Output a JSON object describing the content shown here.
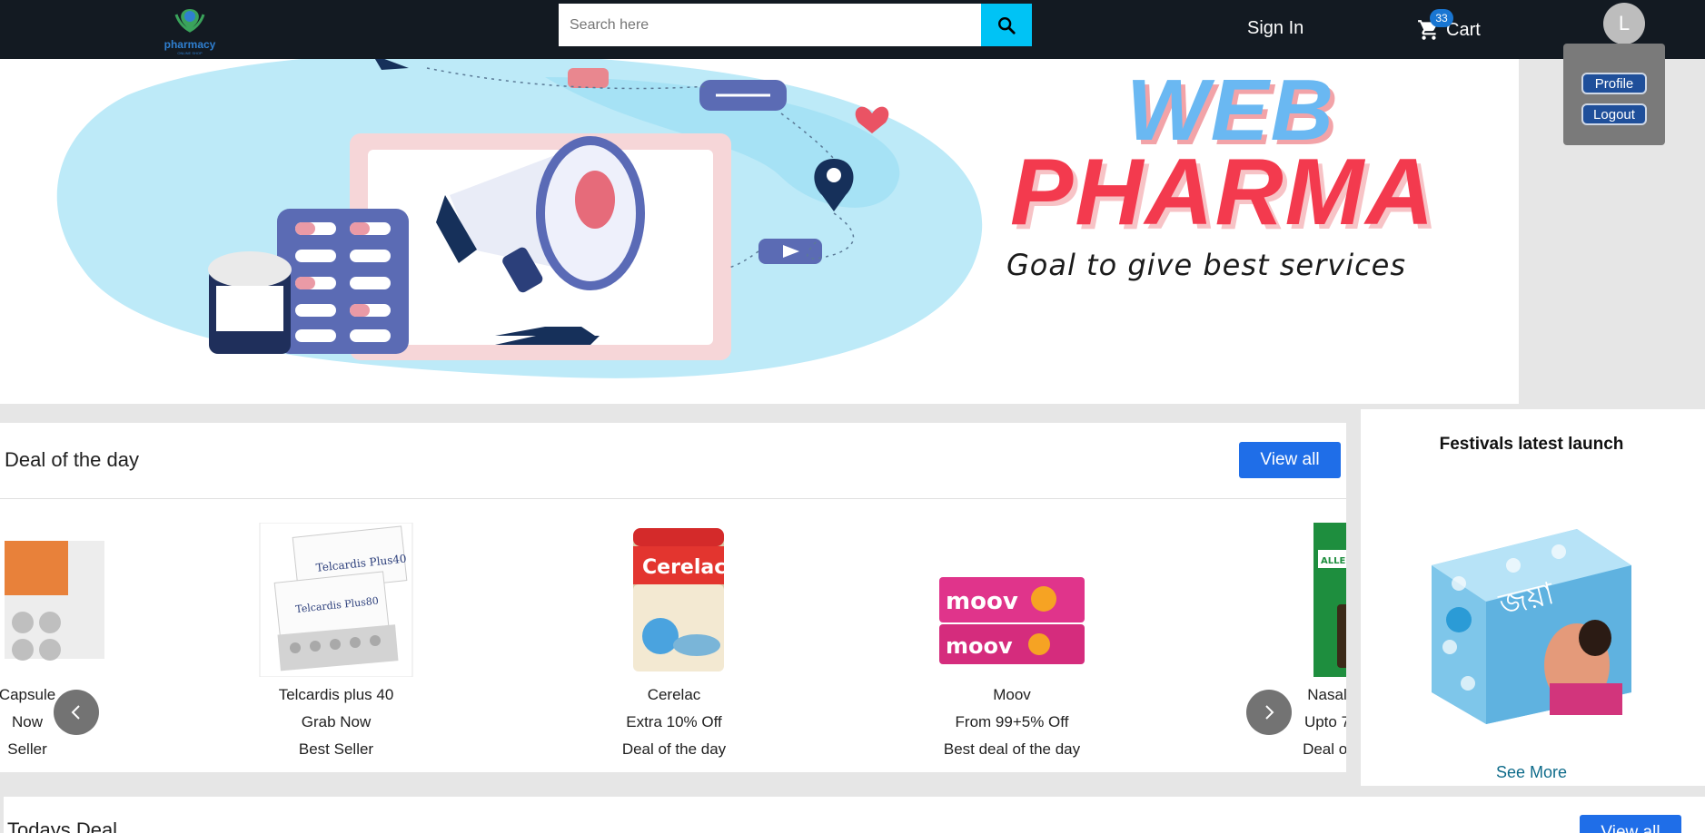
{
  "header": {
    "logo_text": "pharmacy",
    "logo_subtext": "ONLINE SHOP",
    "search_placeholder": "Search here",
    "sign_in_label": "Sign In",
    "cart_label": "Cart",
    "cart_count": "33",
    "avatar_letter": "L"
  },
  "profile_menu": {
    "items": [
      {
        "label": "Profile"
      },
      {
        "label": "Logout"
      }
    ]
  },
  "banner": {
    "brand_line1": "WEB",
    "brand_line2": "PHARMA",
    "tagline": "Goal to give best services"
  },
  "deal_of_day": {
    "title": "Deal of the day",
    "view_all_label": "View all",
    "products": [
      {
        "name": "Capsule",
        "line2": "Now",
        "line3": "Seller"
      },
      {
        "name": "Telcardis plus 40",
        "line2": "Grab Now",
        "line3": "Best Seller"
      },
      {
        "name": "Cerelac",
        "line2": "Extra 10% Off",
        "line3": "Deal of the day"
      },
      {
        "name": "Moov",
        "line2": "From 99+5% Off",
        "line3": "Best deal of the day"
      },
      {
        "name": "Nasal",
        "line2": "Upto 7",
        "line3": "Deal of"
      }
    ]
  },
  "festivals": {
    "title": "Festivals latest launch",
    "see_more_label": "See More"
  },
  "todays_deal": {
    "title": "Todays Deal",
    "view_all_label": "View all"
  },
  "colors": {
    "header_bg": "#131a22",
    "search_button": "#00c3f5",
    "primary_button": "#1f6ee8",
    "brand_blue": "#6ab8f2",
    "brand_red": "#f33a4e"
  }
}
